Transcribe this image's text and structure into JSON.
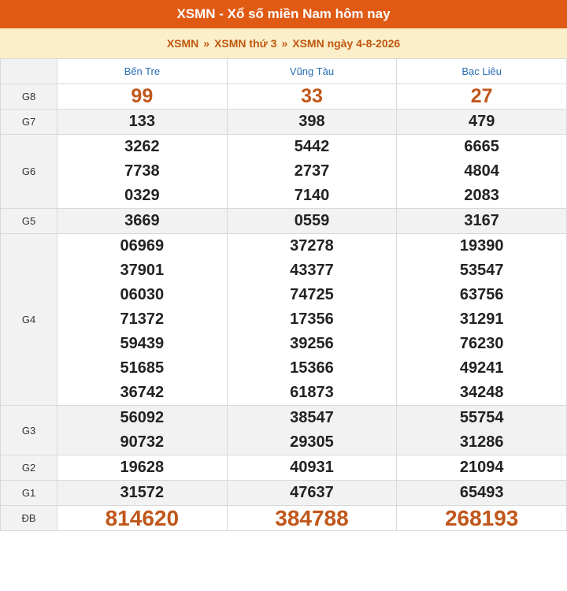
{
  "header": {
    "title": "XSMN - Xổ số miền Nam hôm nay"
  },
  "breadcrumb": {
    "items": [
      "XSMN",
      "XSMN thứ 3",
      "XSMN ngày 4-8-2026"
    ],
    "separator": "»"
  },
  "provinces": [
    "Bến Tre",
    "Vũng Tàu",
    "Bạc Liêu"
  ],
  "prizes": [
    {
      "label": "G8",
      "values": [
        [
          "99"
        ],
        [
          "33"
        ],
        [
          "27"
        ]
      ]
    },
    {
      "label": "G7",
      "values": [
        [
          "133"
        ],
        [
          "398"
        ],
        [
          "479"
        ]
      ]
    },
    {
      "label": "G6",
      "values": [
        [
          "3262",
          "7738",
          "0329"
        ],
        [
          "5442",
          "2737",
          "7140"
        ],
        [
          "6665",
          "4804",
          "2083"
        ]
      ]
    },
    {
      "label": "G5",
      "values": [
        [
          "3669"
        ],
        [
          "0559"
        ],
        [
          "3167"
        ]
      ]
    },
    {
      "label": "G4",
      "values": [
        [
          "06969",
          "37901",
          "06030",
          "71372",
          "59439",
          "51685",
          "36742"
        ],
        [
          "37278",
          "43377",
          "74725",
          "17356",
          "39256",
          "15366",
          "61873"
        ],
        [
          "19390",
          "53547",
          "63756",
          "31291",
          "76230",
          "49241",
          "34248"
        ]
      ]
    },
    {
      "label": "G3",
      "values": [
        [
          "56092",
          "90732"
        ],
        [
          "38547",
          "29305"
        ],
        [
          "55754",
          "31286"
        ]
      ]
    },
    {
      "label": "G2",
      "values": [
        [
          "19628"
        ],
        [
          "40931"
        ],
        [
          "21094"
        ]
      ]
    },
    {
      "label": "G1",
      "values": [
        [
          "31572"
        ],
        [
          "47637"
        ],
        [
          "65493"
        ]
      ]
    },
    {
      "label": "ĐB",
      "values": [
        [
          "814620"
        ],
        [
          "384788"
        ],
        [
          "268193"
        ]
      ]
    }
  ],
  "colors": {
    "header_bg": "#e05a14",
    "crumb_bg": "#fbefcb",
    "accent": "#c0571b",
    "province": "#2a6db5"
  }
}
